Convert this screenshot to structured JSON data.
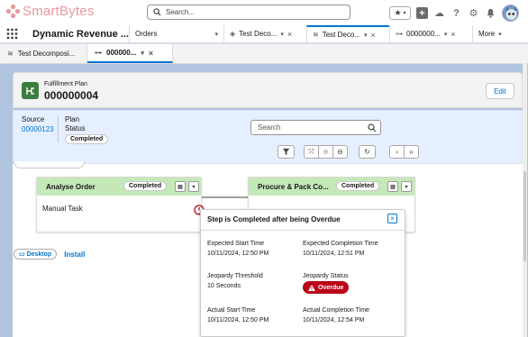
{
  "header": {
    "logo_text": "SmartBytes",
    "search_placeholder": "Search..."
  },
  "nav": {
    "app_name": "Dynamic Revenue ...",
    "tabs": [
      {
        "label": "Orders"
      },
      {
        "label": "Test Deco..."
      },
      {
        "label": "Test Deco..."
      },
      {
        "label": "0000000..."
      },
      {
        "label": "More"
      }
    ]
  },
  "subtabs": [
    {
      "label": "Test Decomposi..."
    },
    {
      "label": "000000..."
    }
  ],
  "record": {
    "type": "Fulfillment Plan",
    "title": "000000004",
    "edit_label": "Edit"
  },
  "plan_bar": {
    "source_label": "Source",
    "source_value": "00000123",
    "plan_label": "Plan",
    "status_label": "Status",
    "status_value": "Completed",
    "search_placeholder": "Search"
  },
  "cards": [
    {
      "title": "Analyse Order",
      "status": "Completed",
      "body": "Manual Task"
    },
    {
      "title": "Procure & Pack Co...",
      "status": "Completed"
    }
  ],
  "popover": {
    "title": "Step is Completed after being Overdue",
    "expected_start_label": "Expected Start Time",
    "expected_start_value": "10/11/2024, 12:50 PM",
    "expected_completion_label": "Expected Completion Time",
    "expected_completion_value": "10/11/2024, 12:51 PM",
    "jeopardy_threshold_label": "Jeopardy Threshold",
    "jeopardy_threshold_value": "10 Seconds",
    "jeopardy_status_label": "Jeopardy Status",
    "jeopardy_status_value": "Overdue",
    "actual_start_label": "Actual Start Time",
    "actual_start_value": "10/11/2024, 12:50 PM",
    "actual_completion_label": "Actual Completion Time",
    "actual_completion_value": "10/11/2024, 12:54 PM"
  },
  "footer": {
    "desktop_label": "Desktop",
    "install_label": "Install"
  }
}
